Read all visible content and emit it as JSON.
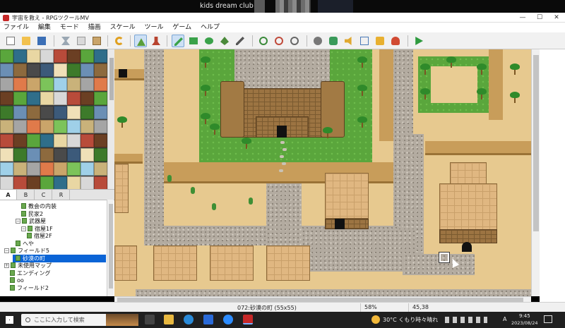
{
  "call": {
    "caption": "kids dream club"
  },
  "window": {
    "title": "宇宙を救え - RPGツクールMV",
    "minimize": "—",
    "maximize": "☐",
    "close": "✕"
  },
  "menu": [
    "ファイル",
    "編集",
    "モード",
    "描画",
    "スケール",
    "ツール",
    "ゲーム",
    "ヘルプ"
  ],
  "toolbar": {
    "icons": [
      "new-project-icon",
      "open-project-icon",
      "save-project-icon",
      "cut-icon",
      "copy-icon",
      "paste-icon",
      "undo-icon",
      "map-mode-icon",
      "event-mode-icon",
      "pencil-icon",
      "rectangle-icon",
      "ellipse-icon",
      "fill-icon",
      "shadow-pen-icon",
      "zoom-in-icon",
      "zoom-out-icon",
      "zoom-actual-icon",
      "database-icon",
      "plugin-manager-icon",
      "sound-test-icon",
      "event-searcher-icon",
      "resource-manager-icon",
      "character-generator-icon",
      "playtest-icon"
    ],
    "active": [
      "map-mode-icon",
      "pencil-icon"
    ]
  },
  "tileset_tabs": [
    "A",
    "B",
    "C",
    "R"
  ],
  "tree": [
    {
      "label": "教会の内装",
      "level": 3,
      "expander": ""
    },
    {
      "label": "民家2",
      "level": 3,
      "expander": ""
    },
    {
      "label": "武器屋",
      "level": 2,
      "expander": "−"
    },
    {
      "label": "宿屋1F",
      "level": 3,
      "expander": "−"
    },
    {
      "label": "宿屋2F",
      "level": 4,
      "expander": ""
    },
    {
      "label": "へや",
      "level": 2,
      "expander": ""
    },
    {
      "label": "フィールド5",
      "level": 0,
      "expander": "−"
    },
    {
      "label": "砂漠の町",
      "level": 1,
      "expander": "",
      "selected": true
    },
    {
      "label": "未使用マップ",
      "level": 0,
      "expander": "+"
    },
    {
      "label": "エンディング",
      "level": 1,
      "expander": ""
    },
    {
      "label": "oo",
      "level": 1,
      "expander": ""
    },
    {
      "label": "フィールド2",
      "level": 1,
      "expander": ""
    }
  ],
  "status": {
    "map": "072:砂漠の町 (55x55)",
    "zoom": "58%",
    "coords": "45,38"
  },
  "taskbar": {
    "search_placeholder": "ここに入力して検索",
    "weather": "30°C くもり時々晴れ",
    "ime": "A",
    "time": "9:45",
    "date": "2023/08/24"
  },
  "colors": {
    "selection": "#0a64d6",
    "grass": "#5aa63c",
    "sand": "#e9cc93"
  }
}
